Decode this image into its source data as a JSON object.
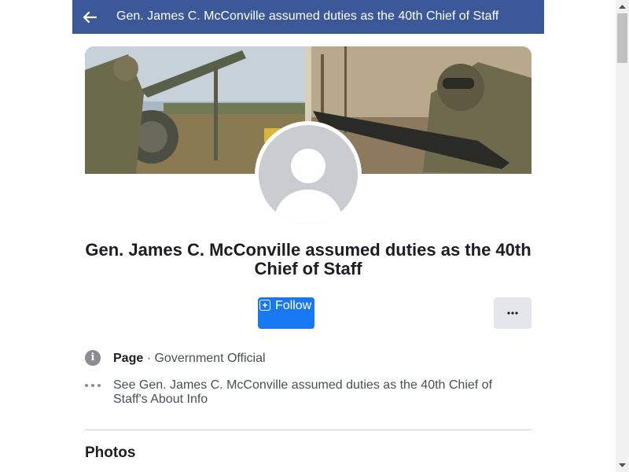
{
  "header": {
    "title": "Gen. James C. McConville assumed duties as the 40th Chief of Staff",
    "back_icon": "arrow-left-icon",
    "color": "#3b5998"
  },
  "profile": {
    "cover_icon": "cover-photo",
    "avatar_icon": "default-avatar-icon",
    "name": "Gen. James C. McConville assumed duties as the 40th Chief of Staff"
  },
  "actions": {
    "follow_label": "Follow",
    "follow_icon": "follow-plus-icon",
    "more_label": "···",
    "follow_color": "#1877f2"
  },
  "info": {
    "type_label": "Page",
    "separator": " · ",
    "category": "Government Official",
    "about_text": "See Gen. James C. McConville assumed duties as the 40th Chief of Staff's About Info"
  },
  "sections": {
    "photos_title": "Photos"
  }
}
